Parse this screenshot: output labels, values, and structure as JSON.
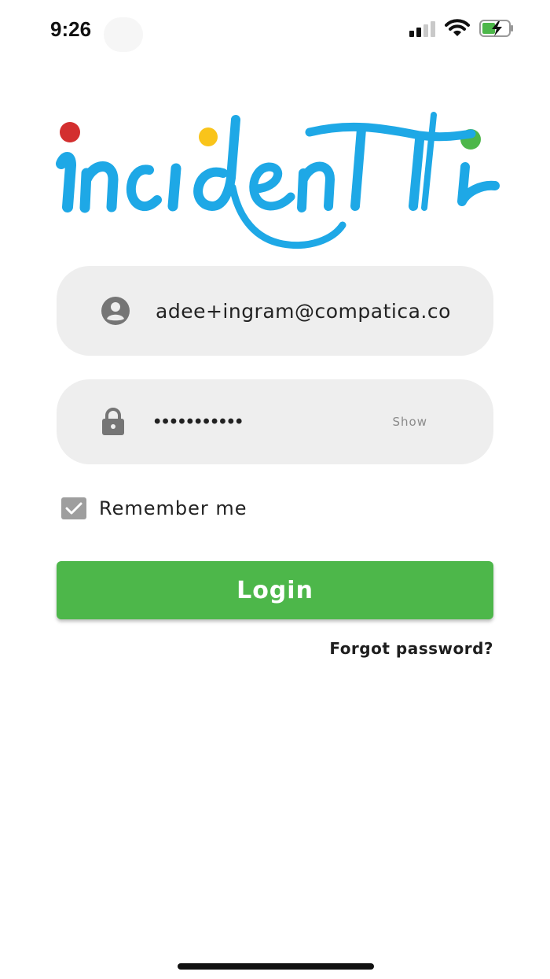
{
  "status_bar": {
    "time": "9:26",
    "icons": [
      "cellular-signal-icon",
      "wifi-icon",
      "battery-charging-icon"
    ]
  },
  "logo": {
    "text": "incidentli",
    "colors": {
      "script": "#1ea8e6",
      "dot_red": "#d32f2f",
      "dot_yellow": "#f9c41a",
      "dot_green": "#4db74a"
    }
  },
  "email_field": {
    "icon": "account-circle-icon",
    "value": "adee+ingram@compatica.co",
    "placeholder": ""
  },
  "password_field": {
    "icon": "lock-icon",
    "value_masked": "•••••••••••",
    "show_label": "Show"
  },
  "remember_me": {
    "label": "Remember me",
    "checked": true
  },
  "login_button": {
    "label": "Login"
  },
  "forgot_password": {
    "label": "Forgot password?"
  },
  "colors": {
    "accent": "#4db74a",
    "field_bg": "#eeeeee",
    "checkbox": "#9e9e9e"
  }
}
